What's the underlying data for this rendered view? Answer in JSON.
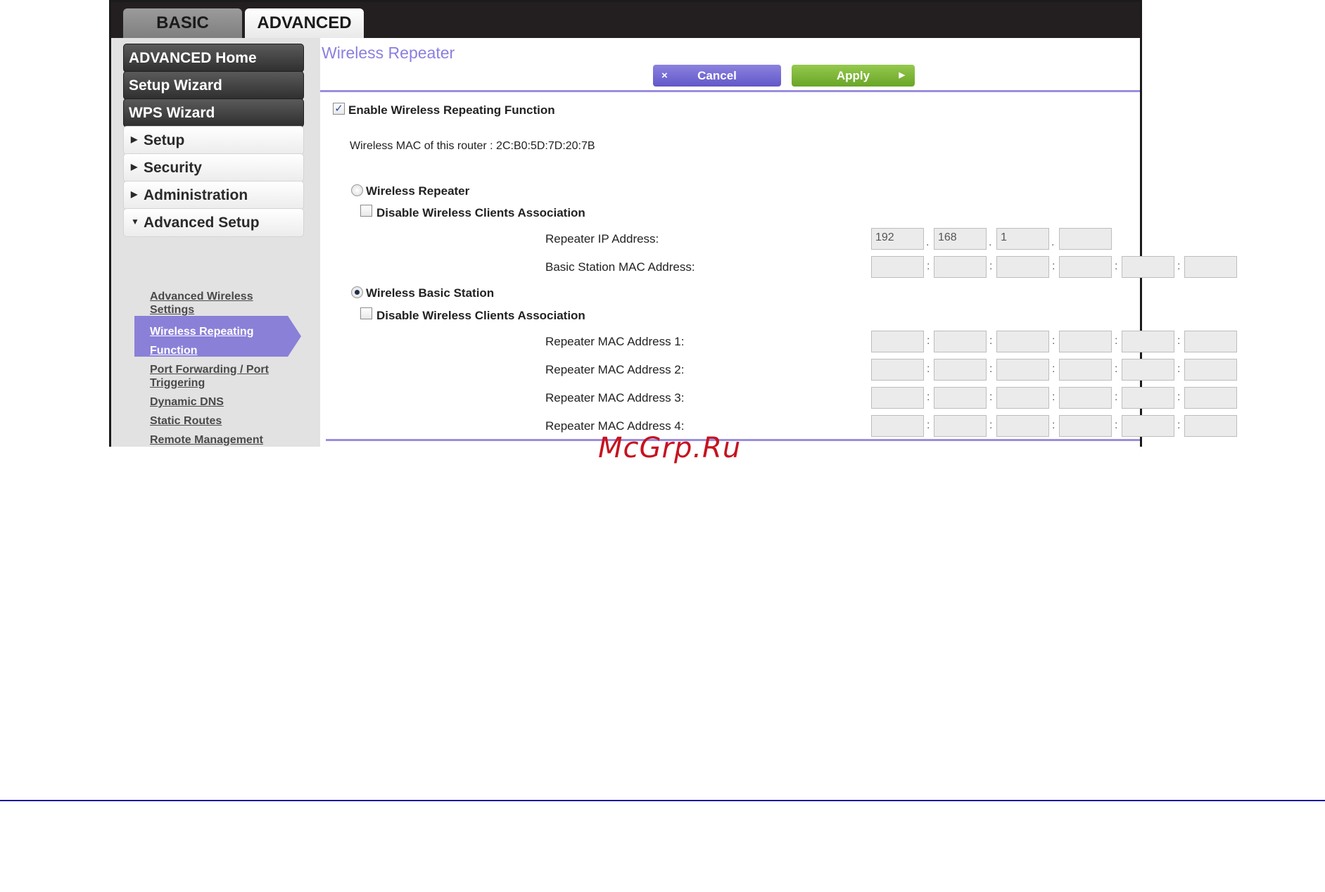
{
  "tabs": {
    "basic": "BASIC",
    "advanced": "ADVANCED"
  },
  "sidebar": {
    "primary": [
      "ADVANCED Home",
      "Setup Wizard",
      "WPS Wizard"
    ],
    "sections": [
      {
        "arrow": "▶",
        "label": "Setup"
      },
      {
        "arrow": "▶",
        "label": "Security"
      },
      {
        "arrow": "▶",
        "label": "Administration"
      },
      {
        "arrow": "▼",
        "label": "Advanced Setup"
      }
    ],
    "links": {
      "advanced_wireless": "Advanced Wireless Settings",
      "wireless_repeating": "Wireless Repeating Function",
      "port_forwarding": "Port Forwarding / Port Triggering",
      "dynamic_dns": "Dynamic DNS",
      "static_routes": "Static Routes",
      "remote_management": "Remote Management"
    }
  },
  "page": {
    "title": "Wireless Repeater",
    "cancel_label": "Cancel",
    "apply_label": "Apply",
    "cancel_icon": "×",
    "apply_icon": "▶",
    "enable_label": "Enable Wireless Repeating Function",
    "enable_checked": "✓",
    "mac_info": "Wireless MAC of this router : 2C:B0:5D:7D:20:7B",
    "repeater": {
      "label": "Wireless Repeater",
      "disable_label": "Disable Wireless Clients Association",
      "ip_label": "Repeater IP Address:",
      "ip_values": [
        "192",
        "168",
        "1",
        ""
      ],
      "mac_label": "Basic Station MAC Address:"
    },
    "basic_station": {
      "label": "Wireless Basic Station",
      "disable_label": "Disable Wireless Clients Association",
      "mac_labels": [
        "Repeater MAC Address 1:",
        "Repeater MAC Address 2:",
        "Repeater MAC Address 3:",
        "Repeater MAC Address 4:"
      ]
    },
    "separators": {
      "dot": ".",
      "colon": ":"
    }
  },
  "watermark": "McGrp.Ru",
  "colors": {
    "accent": "#8a80d8",
    "apply": "#7ab535",
    "watermark": "#c6131f"
  }
}
